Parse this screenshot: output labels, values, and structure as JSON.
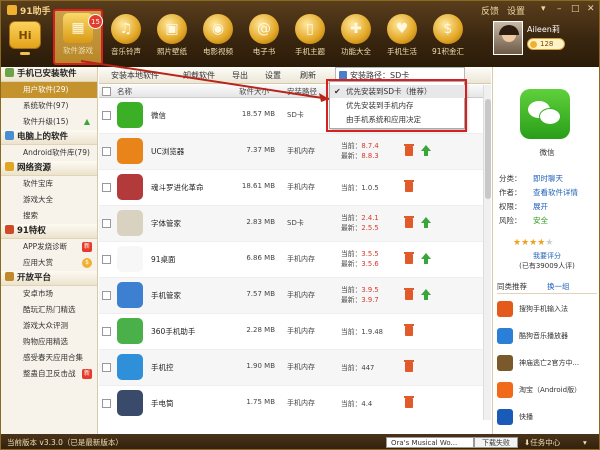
{
  "app": {
    "title": "91助手",
    "feedback": "反馈",
    "settings": "设置"
  },
  "nav": {
    "hi": "Hi",
    "tabs": [
      {
        "label": "软件游戏",
        "badge": "15",
        "icon": "apps-grid-icon"
      },
      {
        "label": "音乐铃声",
        "icon": "music-note-icon"
      },
      {
        "label": "照片壁纸",
        "icon": "photo-icon"
      },
      {
        "label": "电影视频",
        "icon": "film-icon"
      },
      {
        "label": "电子书",
        "icon": "ebook-icon"
      },
      {
        "label": "手机主题",
        "icon": "theme-icon"
      },
      {
        "label": "功能大全",
        "icon": "toolbox-icon"
      },
      {
        "label": "手机生活",
        "icon": "life-icon"
      },
      {
        "label": "91积金汇",
        "icon": "coin-icon"
      }
    ]
  },
  "user": {
    "name": "Aileen莉",
    "points": "128"
  },
  "sidebar": {
    "sections": [
      {
        "title": "手机已安装软件",
        "items": [
          {
            "label": "用户软件(29)",
            "selected": true
          },
          {
            "label": "系统软件(97)"
          },
          {
            "label": "软件升级(15)",
            "tag": "up"
          }
        ]
      },
      {
        "title": "电脑上的软件",
        "items": [
          {
            "label": "Android软件库(79)"
          }
        ]
      },
      {
        "title": "网络资源",
        "items": [
          {
            "label": "软件宝库"
          },
          {
            "label": "游戏大全"
          },
          {
            "label": "搜索"
          }
        ]
      },
      {
        "title": "91特权",
        "items": [
          {
            "label": "APP发烧诊断",
            "tag": "new"
          },
          {
            "label": "应用大赏",
            "tag": "coin"
          }
        ]
      },
      {
        "title": "开放平台",
        "items": [
          {
            "label": "安卓市场"
          },
          {
            "label": "酷玩汇热门精选"
          },
          {
            "label": "游戏大众评测"
          },
          {
            "label": "购物应用精选"
          },
          {
            "label": "感受春天应用合集"
          },
          {
            "label": "整蛊自卫反击战",
            "tag": "new"
          }
        ]
      }
    ]
  },
  "toolbar": {
    "install": "安装本地软件",
    "uninstall": "卸载软件",
    "export": "导出",
    "settings": "设置",
    "refresh": "刷新",
    "path_label": "安装路径：SD卡"
  },
  "dropdown": {
    "options": [
      {
        "label": "优先安装到SD卡（推荐）",
        "checked": true
      },
      {
        "label": "优先安装到手机内存"
      },
      {
        "label": "由手机系统和应用决定"
      }
    ]
  },
  "table": {
    "headers": {
      "name": "名称",
      "size": "软件大小",
      "location": "安装路径",
      "version": "版本"
    },
    "rows": [
      {
        "name": "微信",
        "size": "18.57 MB",
        "location": "SD卡",
        "ver_cur": "",
        "ver_new": "",
        "color": "#3bb026",
        "icon": "wechat-icon"
      },
      {
        "name": "UC浏览器",
        "size": "7.37 MB",
        "location": "手机内存",
        "ver_cur": "8.7.4",
        "ver_new": "8.8.3",
        "color": "#e8841a",
        "icon": "uc-browser-icon",
        "up": true
      },
      {
        "name": "魂斗罗进化革命",
        "size": "18.61 MB",
        "location": "手机内存",
        "ver_cur": "1.0.5",
        "ver_new": "",
        "color": "#b33a3a",
        "icon": "game-icon"
      },
      {
        "name": "字体管家",
        "size": "2.83 MB",
        "location": "SD卡",
        "ver_cur": "2.4.1",
        "ver_new": "2.5.5",
        "color": "#d9d2c0",
        "icon": "font-icon",
        "up": true
      },
      {
        "name": "91桌面",
        "size": "6.86 MB",
        "location": "手机内存",
        "ver_cur": "3.5.5",
        "ver_new": "3.5.6",
        "color": "#f7f7f7",
        "icon": "launcher-icon",
        "up": true
      },
      {
        "name": "手机管家",
        "size": "7.57 MB",
        "location": "手机内存",
        "ver_cur": "3.9.5",
        "ver_new": "3.9.7",
        "color": "#3d7fd0",
        "icon": "shield-icon",
        "up": true
      },
      {
        "name": "360手机助手",
        "size": "2.28 MB",
        "location": "手机内存",
        "ver_cur": "1.9.48",
        "ver_new": "",
        "color": "#4ab04a",
        "icon": "360-icon"
      },
      {
        "name": "手机控",
        "size": "1.90 MB",
        "location": "手机内存",
        "ver_cur": "447",
        "ver_new": "",
        "color": "#2f8fd8",
        "icon": "phone-control-icon"
      },
      {
        "name": "手电筒",
        "size": "1.75 MB",
        "location": "手机内存",
        "ver_cur": "4.4",
        "ver_new": "",
        "color": "#3a4a6a",
        "icon": "flashlight-icon"
      }
    ],
    "cur_prefix": "当前：",
    "new_prefix": "最新："
  },
  "detail": {
    "title": "微信",
    "category_k": "分类：",
    "category_v": "即时聊天",
    "author_k": "作者：",
    "author_v": "查看软件详情",
    "perm_k": "权限：",
    "perm_v": "展开",
    "risk_k": "风险：",
    "risk_v": "安全",
    "rating": 4,
    "rate_link": "我要评分",
    "rating_count": "(已有39009人评)",
    "rec_title": "同类推荐",
    "rec_change": "换一组",
    "recommendations": [
      {
        "label": "搜狗手机输入法",
        "color": "#e45a1a"
      },
      {
        "label": "酷狗音乐播放器",
        "color": "#2b7fd8"
      },
      {
        "label": "神庙逃亡2官方中...",
        "color": "#7a5a2a"
      },
      {
        "label": "淘宝（Android版）",
        "color": "#f06a1a"
      },
      {
        "label": "快播",
        "color": "#1a5ab8"
      }
    ]
  },
  "status": {
    "version": "当前版本 v3.3.0（已是最新版本）",
    "song": "Ora's Musical Wo...",
    "download_fail": "下载失败",
    "task_center": "任务中心"
  }
}
